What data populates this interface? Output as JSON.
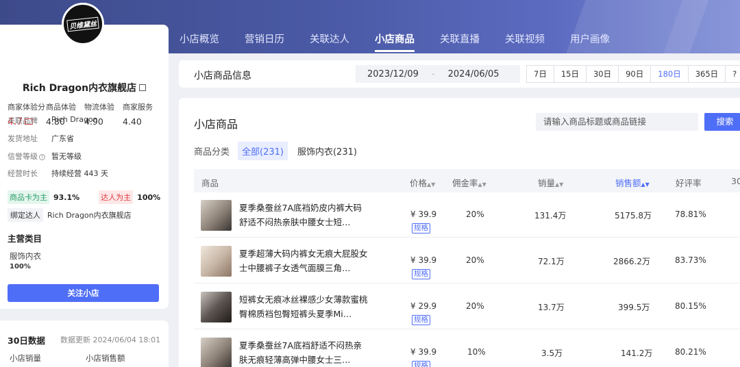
{
  "tabs": [
    "小店概览",
    "营销日历",
    "关联达人",
    "小店商品",
    "关联直播",
    "关联视频",
    "用户画像"
  ],
  "shop": {
    "logo_text": "贝维黛丝",
    "name": "Rich Dragon内衣旗舰店",
    "metrics": [
      {
        "label": "商家体验分",
        "value": "4.7"
      },
      {
        "label": "商品体验",
        "value": "4.80"
      },
      {
        "label": "物流体验",
        "value": "4.90"
      },
      {
        "label": "商家服务",
        "value": "4.40"
      }
    ],
    "brand_label": "关联品牌",
    "brand": "Rich Dragon",
    "ship_label": "发货地址",
    "ship": "广东省",
    "credit_label": "信誉等级",
    "credit": "暂无等级",
    "age_label": "经营时长",
    "age": "持续经营 443 天",
    "tag_goods": "商品卡为主",
    "tag_goods_pct": "93.1%",
    "tag_talent": "达人为主",
    "tag_talent_pct": "100%",
    "bind_label": "绑定达人",
    "bind_value": "Rich Dragon内衣旗舰店",
    "category_title": "主营类目",
    "category_name": "服饰内衣",
    "category_pct": "100%",
    "follow": "关注小店"
  },
  "stats30": {
    "title": "30日数据",
    "update": "数据更新  2024/06/04 18:01",
    "sales_label": "小店销量",
    "amount_label": "小店销售额"
  },
  "datebar": {
    "title": "小店商品信息",
    "start": "2023/12/09",
    "sep": "-",
    "end": "2024/06/05",
    "ranges": [
      "7日",
      "15日",
      "30日",
      "90日",
      "180日",
      "365日",
      "?"
    ],
    "active_range": "180日"
  },
  "products": {
    "title": "小店商品",
    "search_placeholder": "请输入商品标题或商品链接",
    "search_btn": "搜索",
    "cat_label": "商品分类",
    "cat_all": "全部(231)",
    "cat_other": "服饰内衣(231)",
    "headers": {
      "product": "商品",
      "price": "价格",
      "commission": "佣金率",
      "sales": "销量",
      "amount": "销售额",
      "rating": "好评率",
      "extra": "30"
    },
    "spec_label": "规格",
    "rows": [
      {
        "name": "夏季桑蚕丝7A底裆奶皮内裤大码舒适不闷热亲肤中腰女士短…",
        "price": "¥ 39.9",
        "commission": "20%",
        "sales": "131.4万",
        "amount": "5175.8万",
        "rating": "78.81%"
      },
      {
        "name": "夏季超薄大码内裤女无痕大屁股女士中腰裤子女透气面膜三角…",
        "price": "¥ 39.9",
        "commission": "20%",
        "sales": "72.1万",
        "amount": "2866.2万",
        "rating": "83.73%"
      },
      {
        "name": "短裤女无痕冰丝裸感少女薄款蜜桃臀棉质裆包臀短裤头夏季Mi…",
        "price": "¥ 29.9",
        "commission": "20%",
        "sales": "13.7万",
        "amount": "399.5万",
        "rating": "80.15%"
      },
      {
        "name": "夏季桑蚕丝7A底裆舒适不闷热亲肤无痕轻薄高弹中腰女士三…",
        "price": "¥ 39.9",
        "commission": "10%",
        "sales": "3.5万",
        "amount": "141.2万",
        "rating": "80.21%"
      }
    ]
  }
}
